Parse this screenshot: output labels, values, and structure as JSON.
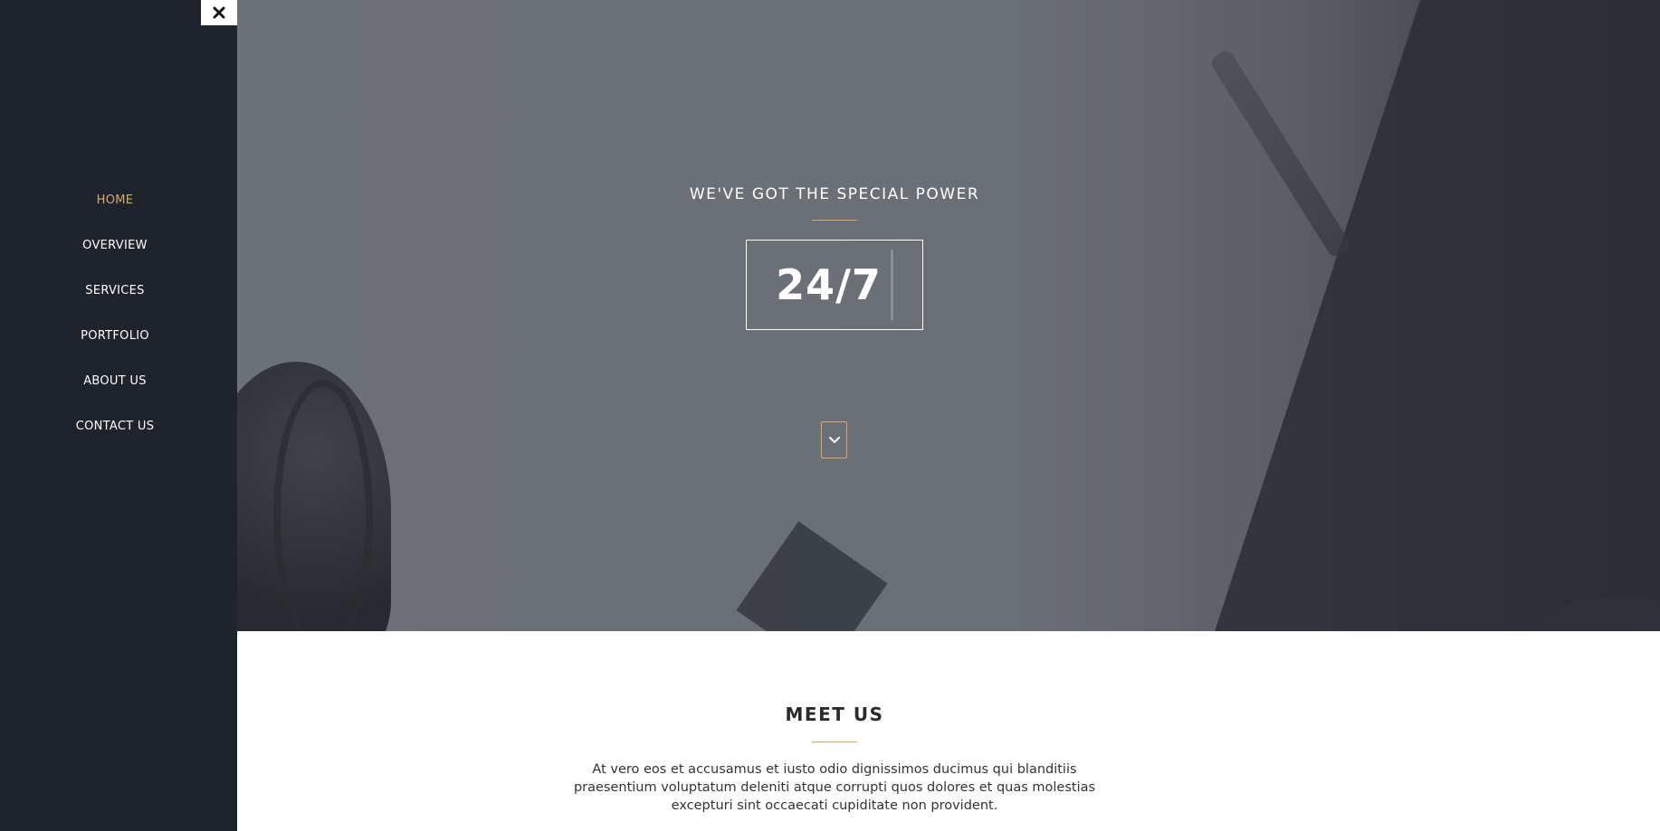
{
  "sidebar": {
    "close_icon": "close-icon",
    "items": [
      {
        "label": "HOME",
        "active": true
      },
      {
        "label": "OVERVIEW",
        "active": false
      },
      {
        "label": "SERVICES",
        "active": false
      },
      {
        "label": "PORTFOLIO",
        "active": false
      },
      {
        "label": "ABOUT US",
        "active": false
      },
      {
        "label": "CONTACT US",
        "active": false
      }
    ]
  },
  "hero": {
    "tagline": "WE'VE GOT THE SPECIAL POWER",
    "highlight": "24/7",
    "scroll_icon": "chevron-down-icon"
  },
  "meet": {
    "title": "MEET US",
    "text": "At vero eos et accusamus et iusto odio dignissimos ducimus qui blanditiis praesentium voluptatum deleniti atque corrupti quos dolores et quas molestias excepturi sint occaecati cupiditate non provident."
  },
  "colors": {
    "accent": "#d9a86c",
    "sidebar_bg": "#1f232b",
    "hero_bg": "#6c7177",
    "text_dark": "#333333"
  }
}
